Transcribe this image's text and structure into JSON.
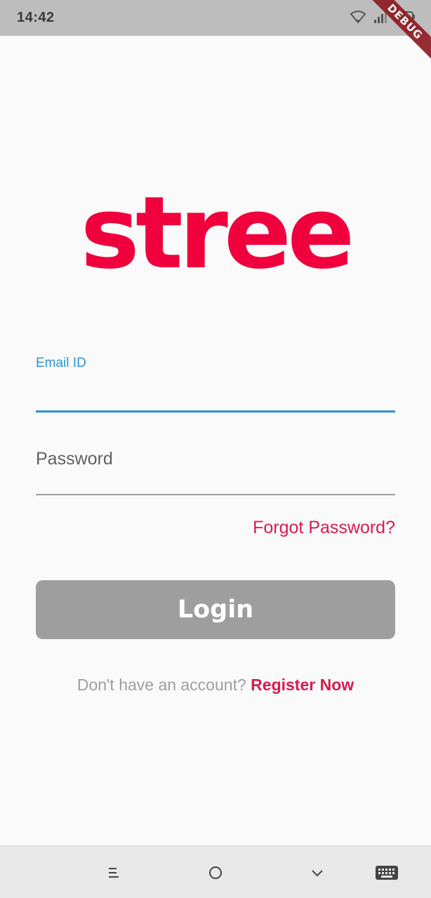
{
  "status_bar": {
    "time": "14:42",
    "icons": [
      "wifi-icon",
      "signal-icon",
      "battery-icon"
    ],
    "debug_banner": "DEBUG"
  },
  "logo": {
    "text": "stree",
    "color": "#f0003c"
  },
  "login_form": {
    "email": {
      "label": "Email ID",
      "value": ""
    },
    "password": {
      "label": "Password",
      "value": ""
    },
    "forgot_password": "Forgot Password?",
    "login_button": "Login",
    "register_prompt": "Don't have an account?",
    "register_link": "Register Now"
  },
  "colors": {
    "accent": "#d81b4f",
    "focus_blue": "#2a93d5",
    "button_disabled": "#9e9e9e"
  },
  "nav_bar": {
    "icons": [
      "menu-icon",
      "home-icon",
      "back-icon",
      "keyboard-icon"
    ]
  }
}
